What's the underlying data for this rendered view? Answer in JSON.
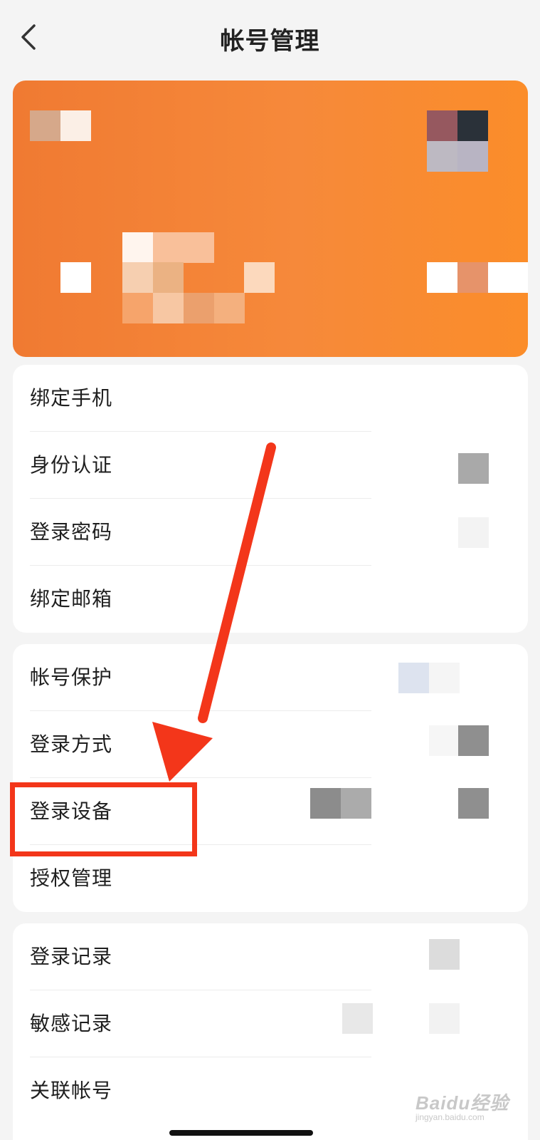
{
  "header": {
    "title": "帐号管理",
    "back_icon": "chevron-left-icon"
  },
  "colors": {
    "accent": "#f6893a",
    "highlight": "#f3361a",
    "background": "#f4f4f4"
  },
  "groups": [
    {
      "items": [
        {
          "label": "绑定手机"
        },
        {
          "label": "身份认证"
        },
        {
          "label": "登录密码"
        },
        {
          "label": "绑定邮箱"
        }
      ]
    },
    {
      "items": [
        {
          "label": "帐号保护"
        },
        {
          "label": "登录方式"
        },
        {
          "label": "登录设备"
        },
        {
          "label": "授权管理"
        }
      ]
    },
    {
      "items": [
        {
          "label": "登录记录"
        },
        {
          "label": "敏感记录"
        },
        {
          "label": "关联帐号"
        }
      ]
    }
  ],
  "watermark": {
    "brand": "Baidu经验",
    "sub": "jingyan.baidu.com"
  }
}
